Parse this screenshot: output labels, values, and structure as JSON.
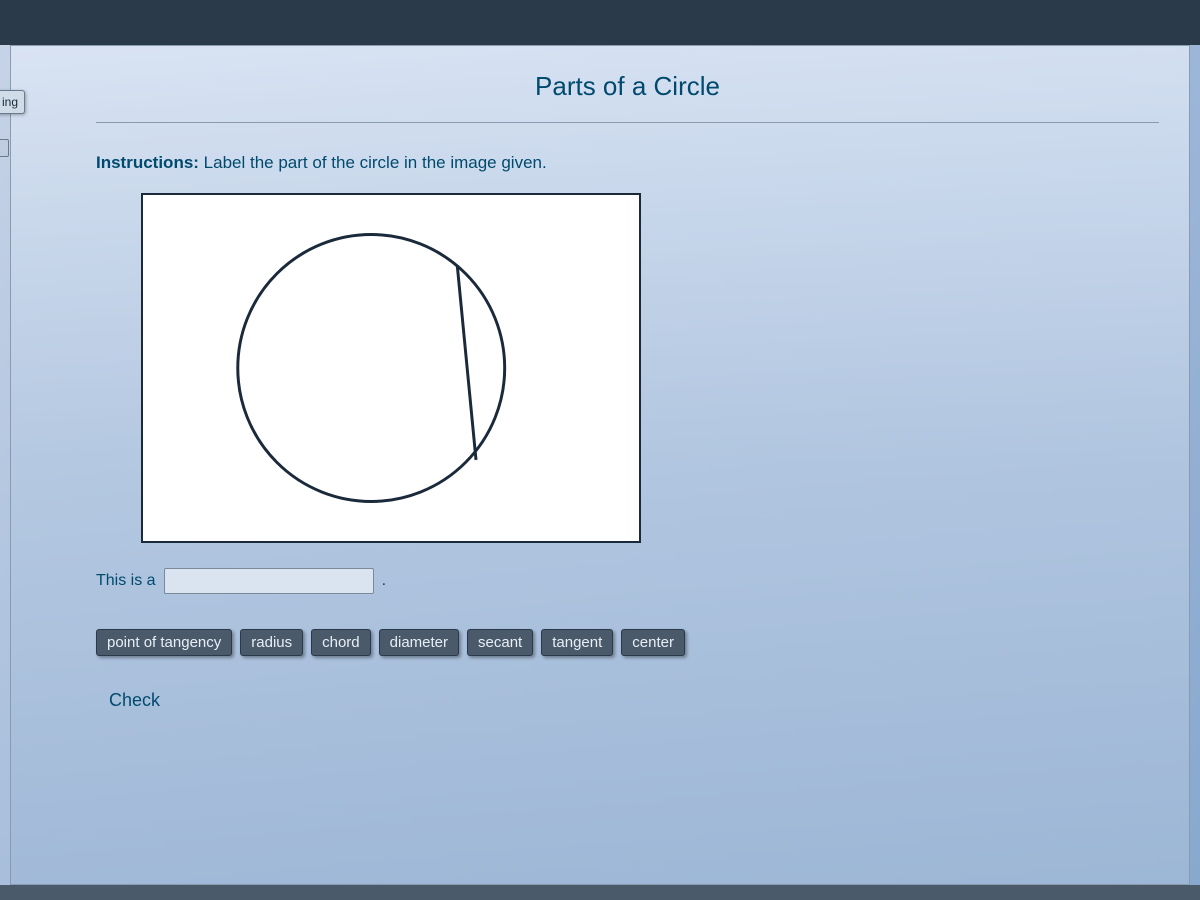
{
  "header": {
    "title": "Parts of a Circle"
  },
  "sidebar": {
    "tab_label": "ing"
  },
  "instructions": {
    "label": "Instructions:",
    "text": " Label the part of the circle in the image given."
  },
  "answer": {
    "prefix": "This is a",
    "value": "",
    "suffix": "."
  },
  "options": [
    "point of tangency",
    "radius",
    "chord",
    "diameter",
    "secant",
    "tangent",
    "center"
  ],
  "actions": {
    "check_label": "Check"
  }
}
